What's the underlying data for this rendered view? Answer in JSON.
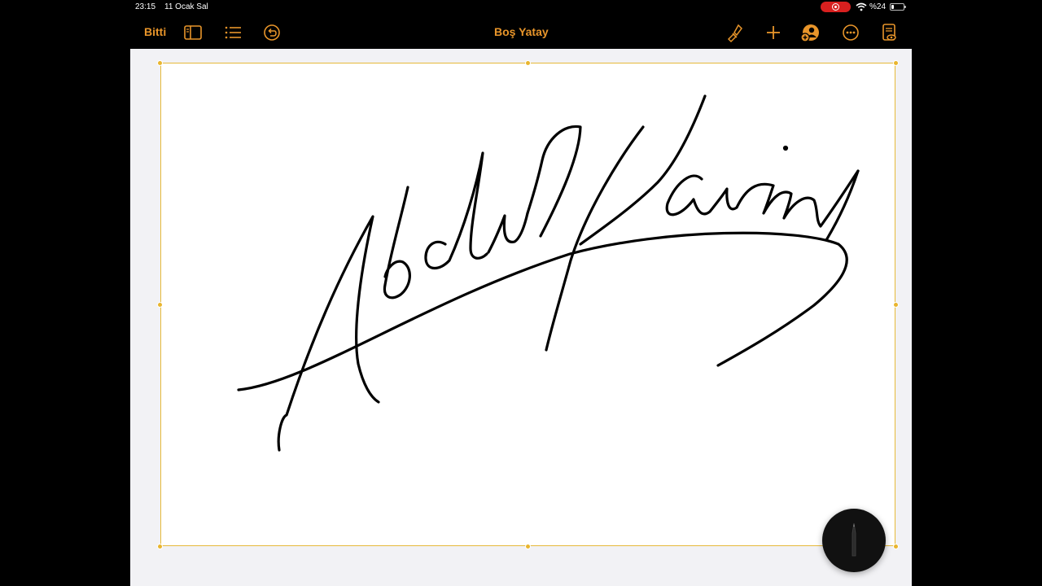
{
  "status": {
    "time": "23:15",
    "date": "11 Ocak Sal",
    "battery": "%24",
    "battery_level": 0.24,
    "recording": true
  },
  "toolbar": {
    "done_label": "Bitti",
    "title": "Boş Yatay",
    "accent_color": "#e8952a",
    "left_icons": [
      "sidebar-icon",
      "list-icon",
      "undo-icon"
    ],
    "right_icons": [
      "brush-icon",
      "plus-icon",
      "collaborate-icon",
      "more-icon",
      "document-view-icon"
    ]
  },
  "drawing": {
    "selection_color": "#e9b52e"
  }
}
